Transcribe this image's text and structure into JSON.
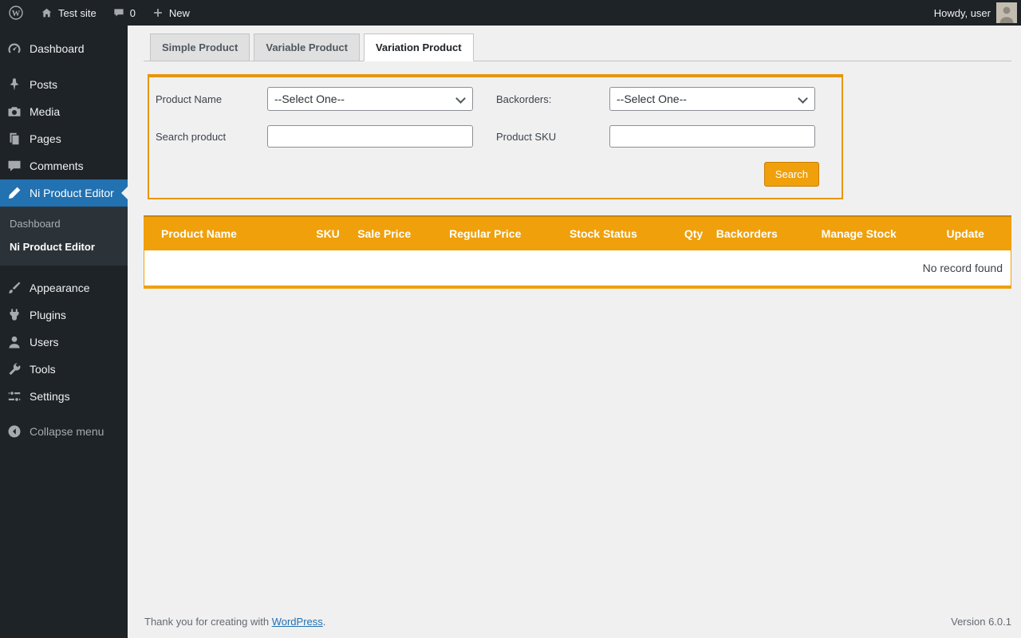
{
  "colors": {
    "accent_orange": "#efa00b",
    "accent_orange_dark": "#c87d00",
    "admin_dark": "#1d2327",
    "active_blue": "#2271b1",
    "content_bg": "#f0f0f1"
  },
  "admin_bar": {
    "site_name": "Test site",
    "comments_count": "0",
    "new_label": "New",
    "howdy_text": "Howdy, user"
  },
  "sidebar": {
    "items": [
      {
        "label": "Dashboard"
      },
      {
        "label": "Posts"
      },
      {
        "label": "Media"
      },
      {
        "label": "Pages"
      },
      {
        "label": "Comments"
      },
      {
        "label": "Ni Product Editor",
        "active": true
      },
      {
        "label": "Appearance"
      },
      {
        "label": "Plugins"
      },
      {
        "label": "Users"
      },
      {
        "label": "Tools"
      },
      {
        "label": "Settings"
      }
    ],
    "submenu": {
      "items": [
        {
          "label": "Dashboard",
          "current": false
        },
        {
          "label": "Ni Product Editor",
          "current": true
        }
      ]
    },
    "collapse_label": "Collapse menu"
  },
  "tabs": [
    {
      "label": "Simple Product",
      "active": false
    },
    {
      "label": "Variable Product",
      "active": false
    },
    {
      "label": "Variation Product",
      "active": true
    }
  ],
  "form": {
    "fields": {
      "product_name": {
        "label": "Product Name",
        "value": "--Select One--"
      },
      "backorders": {
        "label": "Backorders:",
        "value": "--Select One--"
      },
      "search_product": {
        "label": "Search product",
        "value": ""
      },
      "product_sku": {
        "label": "Product SKU",
        "value": ""
      }
    },
    "search_button_label": "Search"
  },
  "table": {
    "columns": [
      "Product Name",
      "SKU",
      "Sale Price",
      "Regular Price",
      "Stock Status",
      "Qty",
      "Backorders",
      "Manage Stock",
      "Update"
    ],
    "empty_message": "No record found"
  },
  "footer": {
    "thanks_text": "Thank you for creating with",
    "wordpress_link_label": "WordPress",
    "period": ".",
    "version": "Version 6.0.1"
  }
}
